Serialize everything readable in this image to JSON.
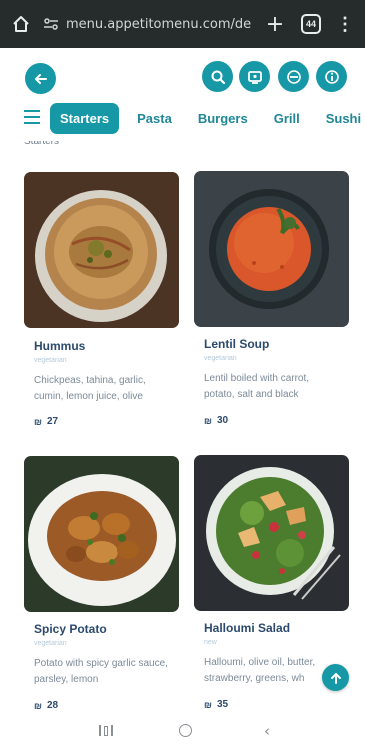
{
  "browser": {
    "url": "menu.appetitomenu.com/de",
    "new_tab_label": "+",
    "tab_count": "44",
    "menu_label": "⋮",
    "icons": [
      "home-icon",
      "site-settings-icon",
      "tabs-icon",
      "overflow-menu-icon"
    ]
  },
  "header": {
    "icons": [
      "back-arrow-icon",
      "search-icon",
      "screen-icon",
      "translate-icon",
      "info-icon"
    ],
    "accent_color": "#1798a6"
  },
  "categories": {
    "items": [
      "Starters",
      "Pasta",
      "Burgers",
      "Grill",
      "Sushi Ro"
    ],
    "active": "Starters"
  },
  "section_title": "Starters",
  "cards": [
    {
      "title": "Hummus",
      "tag": "vegetarian",
      "desc": "Chickpeas, tahina, garlic, cumin, lemon juice, olive",
      "price": "27"
    },
    {
      "title": "Lentil Soup",
      "tag": "vegetarian",
      "desc": "Lentil boiled with carrot, potato, salt and black",
      "price": "30"
    },
    {
      "title": "Spicy Potato",
      "tag": "vegetarian",
      "desc": "Potato with spicy garlic sauce, parsley, lemon",
      "price": "28"
    },
    {
      "title": "Halloumi Salad",
      "tag": "new",
      "desc": "Halloumi, olive oil, butter, strawberry, greens, wh",
      "price": "35"
    }
  ],
  "nav_bar": {
    "icons": [
      "recents-icon",
      "home-circle-icon",
      "back-chevron-icon"
    ]
  }
}
